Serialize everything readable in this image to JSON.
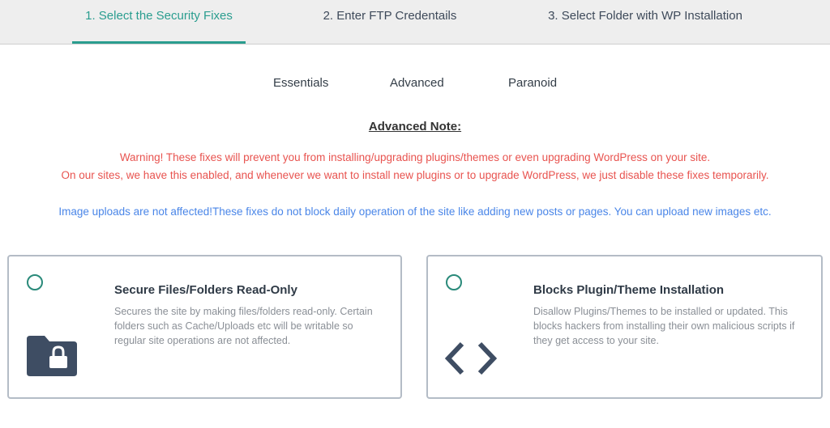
{
  "steps": [
    {
      "label": "1. Select the Security Fixes",
      "active": true
    },
    {
      "label": "2. Enter FTP Credentails",
      "active": false
    },
    {
      "label": "3. Select Folder with WP Installation",
      "active": false
    }
  ],
  "levels": [
    "Essentials",
    "Advanced",
    "Paranoid"
  ],
  "note": {
    "title": "Advanced Note:",
    "warning_line1": "Warning! These fixes will prevent you from installing/upgrading plugins/themes or even upgrading WordPress on your site.",
    "warning_line2": "On our sites, we have this enabled, and whenever we want to install new plugins or to upgrade WordPress, we just disable these fixes temporarily.",
    "info": "Image uploads are not affected!These fixes do not block daily operation of the site like adding new posts or pages. You can upload new images etc."
  },
  "cards": [
    {
      "title": "Secure Files/Folders Read-Only",
      "description": "Secures the site by making files/folders read-only. Certain folders such as Cache/Uploads etc will be writable so regular site operations are not affected.",
      "icon": "lock-folder-icon",
      "selected": false
    },
    {
      "title": "Blocks Plugin/Theme Installation",
      "description": "Disallow Plugins/Themes to be installed or updated. This blocks hackers from installing their own malicious scripts if they get access to your site.",
      "icon": "code-icon",
      "selected": false
    }
  ],
  "colors": {
    "accent": "#2a9d8f",
    "warning": "#e8534f",
    "info": "#4a86e8",
    "icon": "#3e4d63"
  }
}
